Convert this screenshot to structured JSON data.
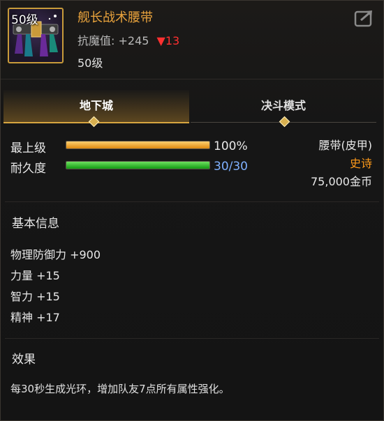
{
  "header": {
    "icon_level": "50级",
    "item_name": "舰长战术腰带",
    "stat_label": "抗魔值:",
    "stat_value": "+245",
    "stat_change": "▼13",
    "item_level": "50级",
    "share_icon": "share-icon"
  },
  "tabs": [
    {
      "label": "地下城",
      "active": true
    },
    {
      "label": "决斗模式",
      "active": false
    }
  ],
  "durability": {
    "grade_label": "最上级",
    "grade_value": "100%",
    "grade_fraction": 1.0,
    "durability_label": "耐久度",
    "durability_value": "30/30",
    "durability_fraction": 1.0
  },
  "item_info": {
    "type": "腰带(皮甲)",
    "rarity": "史诗",
    "price": "75,000金币"
  },
  "basic_info": {
    "title": "基本信息",
    "attributes": [
      "物理防御力 +900",
      "力量 +15",
      "智力 +15",
      "精神 +17"
    ]
  },
  "effect": {
    "title": "效果",
    "text": "每30秒生成光环，增加队友7点所有属性强化。"
  },
  "colors": {
    "name": "#e8a23c",
    "rarity": "#ff9a1a",
    "durability_value": "#7fb0ff",
    "down": "#ff3030"
  }
}
